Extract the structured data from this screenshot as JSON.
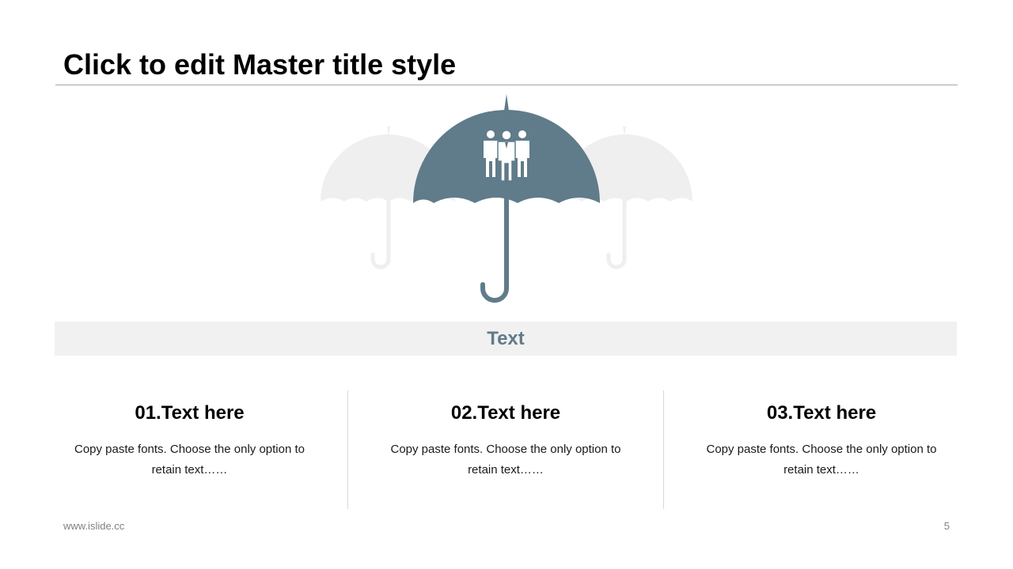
{
  "slide": {
    "title": "Click to edit Master title style",
    "banner": "Text",
    "columns": [
      {
        "heading": "01.Text here",
        "body": "Copy paste fonts. Choose the only option to retain text……"
      },
      {
        "heading": "02.Text here",
        "body": "Copy paste fonts. Choose the only option to retain text……"
      },
      {
        "heading": "03.Text here",
        "body": "Copy paste fonts. Choose the only option to retain text……"
      }
    ],
    "footer_url": "www.islide.cc",
    "page_number": "5"
  },
  "icons": {
    "center": "umbrella-icon",
    "left": "umbrella-icon",
    "right": "umbrella-icon",
    "people": "people-group-icon"
  },
  "colors": {
    "accent": "#607b8a",
    "faded_umbrella": "#efefef",
    "banner_bg": "#f1f1f1",
    "banner_text": "#607b8a"
  }
}
